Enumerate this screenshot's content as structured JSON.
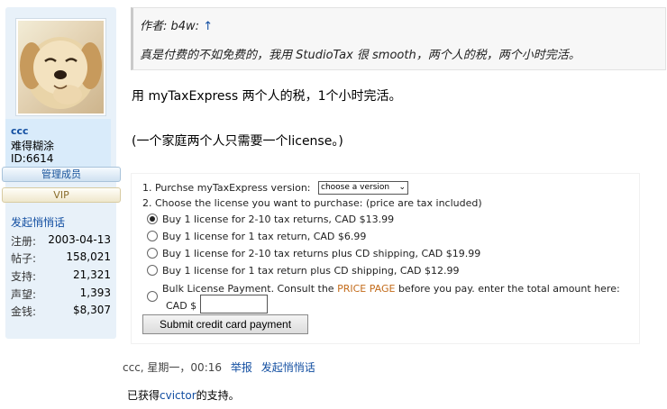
{
  "user": {
    "username": "ccc",
    "title": "难得糊涂",
    "id_text": "ID:6614",
    "badge_admin": "管理成员",
    "badge_vip": "VIP",
    "pm_link": "发起悄悄话",
    "stats": [
      {
        "label": "注册:",
        "value": "2003-04-13"
      },
      {
        "label": "帖子:",
        "value": "158,021"
      },
      {
        "label": "支持:",
        "value": "21,321"
      },
      {
        "label": "声望:",
        "value": "1,393"
      },
      {
        "label": "金钱:",
        "value": "$8,307"
      }
    ]
  },
  "quote": {
    "author_prefix": "作者: ",
    "author": "b4w:",
    "arrow": "↑",
    "text": "真是付费的不如免费的，我用 StudioTax 很 smooth，两个人的税，两个小时完活。"
  },
  "post": {
    "line1": "用 myTaxExpress 两个人的税，1个小时完活。",
    "line2": "(一个家庭两个人只需要一个license。)"
  },
  "form": {
    "step1_label": "1. Purchse myTaxExpress version:",
    "version_select_value": "choose a version",
    "step2_label": "2. Choose the license you want to purchase: (price are tax included)",
    "options": [
      {
        "label": "Buy 1 license for 2-10 tax returns, CAD $13.99",
        "checked": true
      },
      {
        "label": "Buy 1 license for 1 tax return, CAD $6.99",
        "checked": false
      },
      {
        "label": "Buy 1 license for 2-10 tax returns plus CD shipping, CAD $19.99",
        "checked": false
      },
      {
        "label": "Buy 1 license for 1 tax return plus CD shipping, CAD $12.99",
        "checked": false
      }
    ],
    "bulk_before": "Bulk License Payment. Consult the ",
    "bulk_link": "PRICE PAGE",
    "bulk_after": " before you pay. enter the total amount here:",
    "cad_label": "CAD $",
    "cad_value": "",
    "submit_label": "Submit credit card payment"
  },
  "footer": {
    "meta": "ccc, 星期一，00:16",
    "report_link": "举报",
    "pm_link": "发起悄悄话",
    "support_prefix": "已获得",
    "support_user": "cvictor",
    "support_suffix": "的支持。"
  },
  "colors": {
    "link_blue": "#124ea1",
    "panel_bg": "#e8f1f9",
    "price_link": "#c36b1a"
  }
}
